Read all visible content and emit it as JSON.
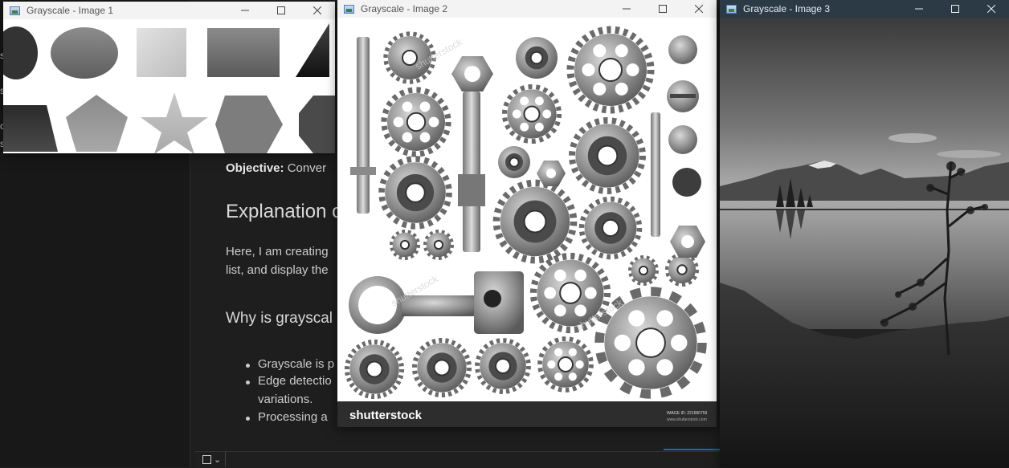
{
  "editor": {
    "objective_label": "Objective:",
    "objective_text": "Conver",
    "heading1": "Explanation o",
    "para_line1": "Here, I am creating",
    "para_line2": "list, and display the",
    "heading2": "Why is grayscal",
    "bullets": [
      "Grayscale is p",
      "Edge detectio",
      "Processing a"
    ],
    "bullet2_cont": "variations.",
    "sidebar_fragments": [
      "s",
      "s",
      "c",
      "s"
    ]
  },
  "windows": {
    "image1": {
      "title": "Grayscale - Image 1"
    },
    "image2": {
      "title": "Grayscale - Image 2",
      "brand": "shutterstock",
      "image_id": "IMAGE ID: 221680759",
      "site": "www.shutterstock.com"
    },
    "image3": {
      "title": "Grayscale - Image 3"
    }
  },
  "icons": {
    "minimize": "minimize-icon",
    "maximize": "maximize-icon",
    "close": "close-icon"
  }
}
